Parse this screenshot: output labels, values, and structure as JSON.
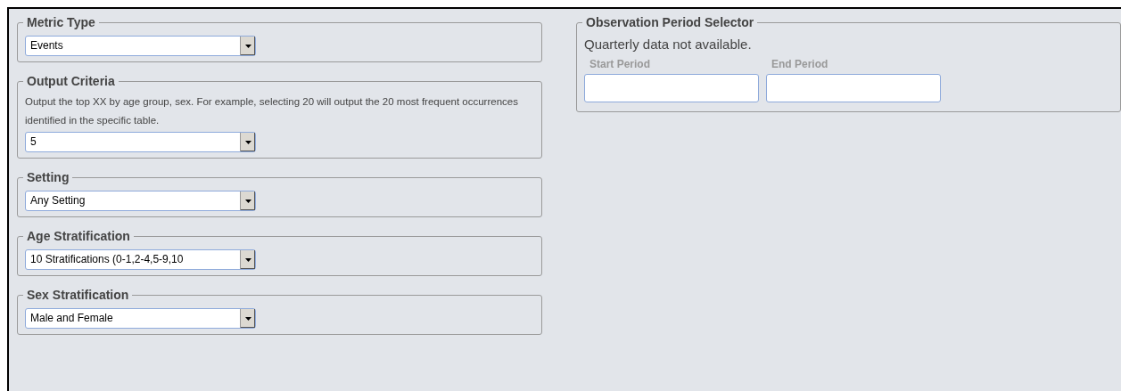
{
  "left_panels": [
    {
      "title": "Metric Type",
      "value": "Events"
    },
    {
      "title": "Output Criteria",
      "description": "Output the top XX by age group, sex. For example, selecting 20 will output the 20 most frequent occurrences identified in the specific table.",
      "value": "5"
    },
    {
      "title": "Setting",
      "value": "Any Setting"
    },
    {
      "title": "Age Stratification",
      "value": "10 Stratifications (0-1,2-4,5-9,10"
    },
    {
      "title": "Sex Stratification",
      "value": "Male and Female"
    }
  ],
  "observation_period": {
    "title": "Observation Period Selector",
    "note": "Quarterly data not available.",
    "fields": [
      {
        "label": "Start Period"
      },
      {
        "label": "End Period"
      }
    ]
  }
}
